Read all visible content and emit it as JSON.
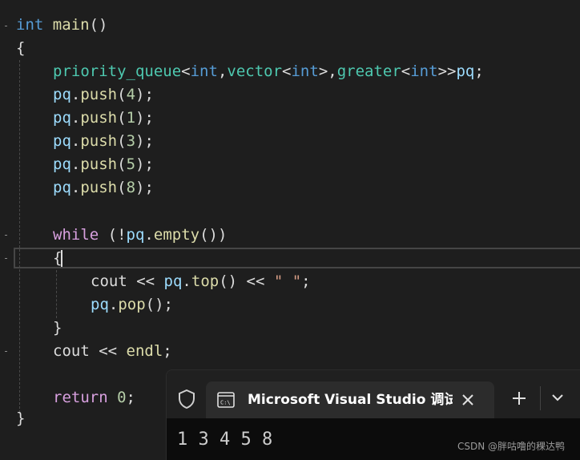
{
  "editor": {
    "lines": [
      {
        "tokens": [
          {
            "t": "int",
            "c": "kw"
          },
          {
            "t": " ",
            "c": "pl"
          },
          {
            "t": "main",
            "c": "fn"
          },
          {
            "t": "()",
            "c": "pl"
          }
        ]
      },
      {
        "tokens": [
          {
            "t": "{",
            "c": "pl"
          }
        ]
      },
      {
        "tokens": [
          {
            "t": "priority_queue",
            "c": "ty"
          },
          {
            "t": "<",
            "c": "pl"
          },
          {
            "t": "int",
            "c": "kw"
          },
          {
            "t": ",",
            "c": "pl"
          },
          {
            "t": "vector",
            "c": "ty"
          },
          {
            "t": "<",
            "c": "pl"
          },
          {
            "t": "int",
            "c": "kw"
          },
          {
            "t": ">,",
            "c": "pl"
          },
          {
            "t": "greater",
            "c": "ty"
          },
          {
            "t": "<",
            "c": "pl"
          },
          {
            "t": "int",
            "c": "kw"
          },
          {
            "t": ">>",
            "c": "pl"
          },
          {
            "t": "pq",
            "c": "var"
          },
          {
            "t": ";",
            "c": "pl"
          }
        ]
      },
      {
        "tokens": [
          {
            "t": "pq",
            "c": "var"
          },
          {
            "t": ".",
            "c": "pl"
          },
          {
            "t": "push",
            "c": "fn"
          },
          {
            "t": "(",
            "c": "pl"
          },
          {
            "t": "4",
            "c": "num"
          },
          {
            "t": ");",
            "c": "pl"
          }
        ]
      },
      {
        "tokens": [
          {
            "t": "pq",
            "c": "var"
          },
          {
            "t": ".",
            "c": "pl"
          },
          {
            "t": "push",
            "c": "fn"
          },
          {
            "t": "(",
            "c": "pl"
          },
          {
            "t": "1",
            "c": "num"
          },
          {
            "t": ");",
            "c": "pl"
          }
        ]
      },
      {
        "tokens": [
          {
            "t": "pq",
            "c": "var"
          },
          {
            "t": ".",
            "c": "pl"
          },
          {
            "t": "push",
            "c": "fn"
          },
          {
            "t": "(",
            "c": "pl"
          },
          {
            "t": "3",
            "c": "num"
          },
          {
            "t": ");",
            "c": "pl"
          }
        ]
      },
      {
        "tokens": [
          {
            "t": "pq",
            "c": "var"
          },
          {
            "t": ".",
            "c": "pl"
          },
          {
            "t": "push",
            "c": "fn"
          },
          {
            "t": "(",
            "c": "pl"
          },
          {
            "t": "5",
            "c": "num"
          },
          {
            "t": ");",
            "c": "pl"
          }
        ]
      },
      {
        "tokens": [
          {
            "t": "pq",
            "c": "var"
          },
          {
            "t": ".",
            "c": "pl"
          },
          {
            "t": "push",
            "c": "fn"
          },
          {
            "t": "(",
            "c": "pl"
          },
          {
            "t": "8",
            "c": "num"
          },
          {
            "t": ");",
            "c": "pl"
          }
        ]
      },
      {
        "tokens": []
      },
      {
        "tokens": [
          {
            "t": "while",
            "c": "kw2"
          },
          {
            "t": " (!",
            "c": "pl"
          },
          {
            "t": "pq",
            "c": "var"
          },
          {
            "t": ".",
            "c": "pl"
          },
          {
            "t": "empty",
            "c": "fn"
          },
          {
            "t": "())",
            "c": "pl"
          }
        ]
      },
      {
        "tokens": [
          {
            "t": "{",
            "c": "pl"
          }
        ]
      },
      {
        "tokens": [
          {
            "t": "cout",
            "c": "pl"
          },
          {
            "t": " << ",
            "c": "pl"
          },
          {
            "t": "pq",
            "c": "var"
          },
          {
            "t": ".",
            "c": "pl"
          },
          {
            "t": "top",
            "c": "fn"
          },
          {
            "t": "() << ",
            "c": "pl"
          },
          {
            "t": "\" \"",
            "c": "str"
          },
          {
            "t": ";",
            "c": "pl"
          }
        ]
      },
      {
        "tokens": [
          {
            "t": "pq",
            "c": "var"
          },
          {
            "t": ".",
            "c": "pl"
          },
          {
            "t": "pop",
            "c": "fn"
          },
          {
            "t": "();",
            "c": "pl"
          }
        ]
      },
      {
        "tokens": [
          {
            "t": "}",
            "c": "pl"
          }
        ]
      },
      {
        "tokens": [
          {
            "t": "cout",
            "c": "pl"
          },
          {
            "t": " << ",
            "c": "pl"
          },
          {
            "t": "endl",
            "c": "fn"
          },
          {
            "t": ";",
            "c": "pl"
          }
        ]
      },
      {
        "tokens": []
      },
      {
        "tokens": [
          {
            "t": "return",
            "c": "kw2"
          },
          {
            "t": " ",
            "c": "pl"
          },
          {
            "t": "0",
            "c": "num"
          },
          {
            "t": ";",
            "c": "pl"
          }
        ]
      },
      {
        "tokens": [
          {
            "t": "}",
            "c": "pl"
          }
        ]
      }
    ]
  },
  "terminal": {
    "tab_title": "Microsoft Visual Studio 调试控制台",
    "output": "1 3 4 5 8"
  },
  "watermark": "CSDN @胖咕噜的稞达鸭"
}
